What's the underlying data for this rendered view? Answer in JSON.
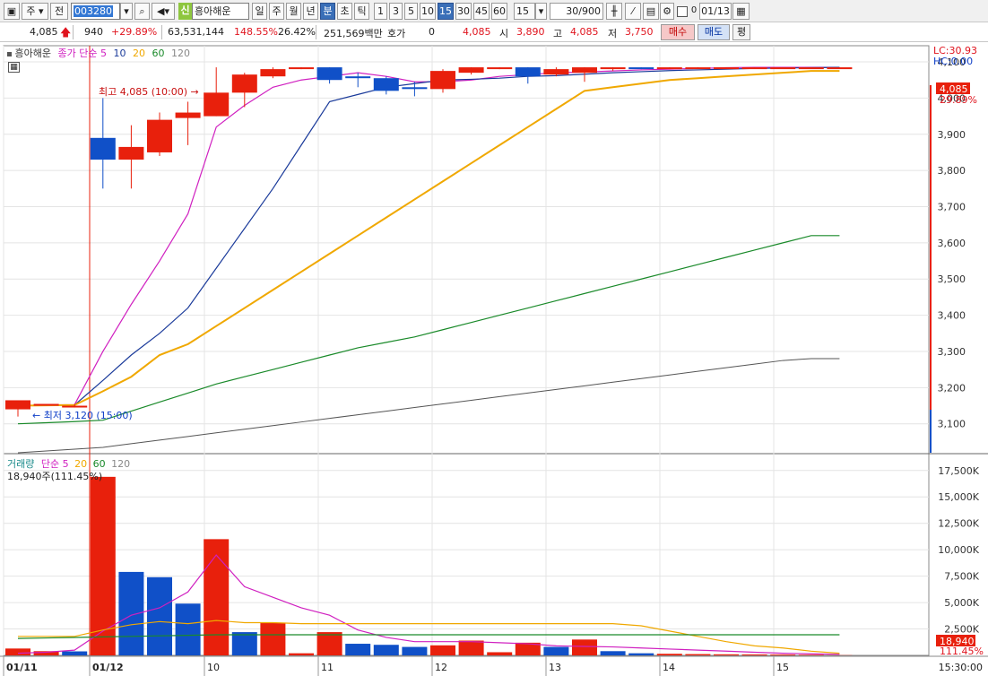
{
  "toolbar": {
    "market": "주",
    "prev_label": "전",
    "code": "003280",
    "stock_name": "흥아해운",
    "sin_label": "신",
    "periods": [
      "일",
      "주",
      "월",
      "년",
      "분",
      "초",
      "틱"
    ],
    "active_period": "분",
    "intervals": [
      "1",
      "3",
      "5",
      "10",
      "15",
      "30",
      "45",
      "60"
    ],
    "active_interval": "15",
    "interval_value": "15",
    "count": "30",
    "count_total": "/900",
    "date": "01/13"
  },
  "quote": {
    "price": "4,085",
    "change": "940",
    "change_pct": "+29.89%",
    "volume": "63,531,144",
    "volume_ratio": "148.55%",
    "turnover": "26.42%",
    "amount": "251,569백만",
    "hoga_label": "호가",
    "hoga_value": "0",
    "price2": "4,085",
    "open_label": "시",
    "open": "3,890",
    "high_label": "고",
    "high": "4,085",
    "low_label": "저",
    "low": "3,750",
    "buy_label": "매수",
    "sell_label": "매도",
    "pyeong_label": "평"
  },
  "price_panel": {
    "legend_name": "흥아해운",
    "legend_ma": "종가 단순",
    "ma_periods": [
      "5",
      "10",
      "20",
      "60",
      "120"
    ],
    "lc_label": "LC:30.93",
    "hc_label": "HC:0.00",
    "high_annot": "최고 4,085 (10:00)",
    "low_annot": "최저 3,120 (15:00)",
    "current_price_tag": "4,085",
    "current_pct_tag": "29.89%",
    "y_ticks": [
      "4,100",
      "4,000",
      "3,900",
      "3,800",
      "3,700",
      "3,600",
      "3,500",
      "3,400",
      "3,300",
      "3,200",
      "3,100"
    ]
  },
  "volume_panel": {
    "legend_name": "거래량",
    "legend_ma": "단순",
    "ma_periods": [
      "5",
      "20",
      "60",
      "120"
    ],
    "current_label": "18,940주(111.45%)",
    "current_tag": "18,940",
    "current_pct_tag": "111.45%",
    "y_ticks": [
      "17,500K",
      "15,000K",
      "12,500K",
      "10,000K",
      "7,500K",
      "5,000K",
      "2,500K"
    ]
  },
  "x_axis": {
    "labels": [
      "01/11",
      "01/12",
      "10",
      "11",
      "12",
      "13",
      "14",
      "15"
    ],
    "time_tag": "15:30:00"
  },
  "colors": {
    "up": "#e8200c",
    "down": "#1050c8",
    "ma5": "#d020c0",
    "ma10": "#1a3a9a",
    "ma20": "#f0a800",
    "ma60": "#1a8a2a",
    "ma120": "#555555"
  },
  "chart_data": {
    "type": "candlestick",
    "candles": [
      {
        "x": "01/11 15:00",
        "open": 3140,
        "high": 3165,
        "low": 3120,
        "close": 3165
      },
      {
        "x": "01/11 15:15",
        "open": 3150,
        "high": 3155,
        "low": 3150,
        "close": 3155
      },
      {
        "x": "01/11 15:30",
        "open": 3150,
        "high": 3155,
        "low": 3145,
        "close": 3150
      },
      {
        "x": "01/12 09:00",
        "open": 3890,
        "high": 4000,
        "low": 3750,
        "close": 3830
      },
      {
        "x": "01/12 09:15",
        "open": 3830,
        "high": 3925,
        "low": 3750,
        "close": 3865
      },
      {
        "x": "01/12 09:30",
        "open": 3850,
        "high": 3960,
        "low": 3840,
        "close": 3940
      },
      {
        "x": "01/12 09:45",
        "open": 3945,
        "high": 3990,
        "low": 3870,
        "close": 3960
      },
      {
        "x": "01/12 10:00",
        "open": 3950,
        "high": 4085,
        "low": 3950,
        "close": 4015
      },
      {
        "x": "01/12 10:15",
        "open": 4015,
        "high": 4070,
        "low": 3975,
        "close": 4065
      },
      {
        "x": "01/12 10:30",
        "open": 4060,
        "high": 4085,
        "low": 4055,
        "close": 4080
      },
      {
        "x": "01/12 10:45",
        "open": 4085,
        "high": 4085,
        "low": 4080,
        "close": 4085
      },
      {
        "x": "01/12 11:00",
        "open": 4085,
        "high": 4085,
        "low": 4040,
        "close": 4050
      },
      {
        "x": "01/12 11:15",
        "open": 4060,
        "high": 4070,
        "low": 4030,
        "close": 4055
      },
      {
        "x": "01/12 11:30",
        "open": 4055,
        "high": 4060,
        "low": 4010,
        "close": 4020
      },
      {
        "x": "01/12 11:45",
        "open": 4030,
        "high": 4045,
        "low": 4005,
        "close": 4025
      },
      {
        "x": "01/12 12:00",
        "open": 4025,
        "high": 4080,
        "low": 4015,
        "close": 4075
      },
      {
        "x": "01/12 12:15",
        "open": 4070,
        "high": 4085,
        "low": 4065,
        "close": 4085
      },
      {
        "x": "01/12 12:30",
        "open": 4085,
        "high": 4085,
        "low": 4080,
        "close": 4085
      },
      {
        "x": "01/12 12:45",
        "open": 4085,
        "high": 4085,
        "low": 4040,
        "close": 4060
      },
      {
        "x": "01/12 13:00",
        "open": 4065,
        "high": 4085,
        "low": 4060,
        "close": 4080
      },
      {
        "x": "01/12 13:15",
        "open": 4070,
        "high": 4085,
        "low": 4045,
        "close": 4085
      },
      {
        "x": "01/12 13:30",
        "open": 4080,
        "high": 4085,
        "low": 4075,
        "close": 4085
      },
      {
        "x": "01/12 13:45",
        "open": 4085,
        "high": 4085,
        "low": 4080,
        "close": 4082
      },
      {
        "x": "01/12 14:00",
        "open": 4082,
        "high": 4085,
        "low": 4080,
        "close": 4085
      },
      {
        "x": "01/12 14:15",
        "open": 4085,
        "high": 4085,
        "low": 4084,
        "close": 4085
      },
      {
        "x": "01/12 14:30",
        "open": 4085,
        "high": 4085,
        "low": 4084,
        "close": 4085
      },
      {
        "x": "01/12 14:45",
        "open": 4085,
        "high": 4085,
        "low": 4084,
        "close": 4085
      },
      {
        "x": "01/12 15:00",
        "open": 4085,
        "high": 4085,
        "low": 4084,
        "close": 4085
      },
      {
        "x": "01/12 15:15",
        "open": 4085,
        "high": 4085,
        "low": 4084,
        "close": 4085
      },
      {
        "x": "01/12 15:30",
        "open": 4085,
        "high": 4085,
        "low": 4084,
        "close": 4085
      }
    ],
    "volume_k": [
      650,
      400,
      380,
      16900,
      7900,
      7400,
      4900,
      11000,
      2200,
      3100,
      200,
      2200,
      1100,
      1000,
      800,
      950,
      1400,
      300,
      1200,
      800,
      1500,
      400,
      200,
      150,
      120,
      100,
      90,
      80,
      60,
      19
    ],
    "volume_up": [
      true,
      true,
      false,
      true,
      false,
      false,
      false,
      true,
      false,
      true,
      true,
      true,
      false,
      false,
      false,
      true,
      true,
      true,
      true,
      false,
      true,
      false,
      false,
      true,
      true,
      true,
      true,
      true,
      true,
      true
    ],
    "ma": {
      "5": [
        3150,
        3152,
        3153,
        3300,
        3430,
        3550,
        3680,
        3920,
        3980,
        4030,
        4050,
        4060,
        4070,
        4060,
        4045,
        4045,
        4050,
        4060,
        4065,
        4070,
        4072,
        4075,
        4078,
        4080,
        4082,
        4084,
        4085,
        4085,
        4085,
        4085
      ],
      "10": [
        3150,
        3151,
        3152,
        3220,
        3290,
        3350,
        3420,
        3530,
        3640,
        3750,
        3870,
        3990,
        4010,
        4030,
        4040,
        4050,
        4052,
        4055,
        4060,
        4062,
        4066,
        4070,
        4073,
        4076,
        4078,
        4080,
        4082,
        4083,
        4084,
        4085
      ],
      "20": [
        3150,
        3151,
        3152,
        3190,
        3230,
        3290,
        3320,
        3370,
        3420,
        3470,
        3520,
        3570,
        3620,
        3670,
        3720,
        3770,
        3820,
        3870,
        3920,
        3970,
        4020,
        4030,
        4040,
        4050,
        4055,
        4060,
        4065,
        4070,
        4075,
        4075
      ],
      "60": [
        3100,
        3103,
        3106,
        3110,
        3135,
        3160,
        3185,
        3210,
        3230,
        3250,
        3270,
        3290,
        3310,
        3325,
        3340,
        3360,
        3380,
        3400,
        3420,
        3440,
        3460,
        3480,
        3500,
        3520,
        3540,
        3560,
        3580,
        3600,
        3620,
        3620
      ],
      "120": [
        3020,
        3025,
        3030,
        3035,
        3045,
        3055,
        3065,
        3075,
        3085,
        3095,
        3105,
        3115,
        3125,
        3135,
        3145,
        3155,
        3165,
        3175,
        3185,
        3195,
        3205,
        3215,
        3225,
        3235,
        3245,
        3255,
        3265,
        3275,
        3280,
        3280
      ]
    },
    "vol_ma": {
      "5": [
        200,
        300,
        500,
        2300,
        3800,
        4500,
        6000,
        9500,
        6500,
        5500,
        4500,
        3800,
        2400,
        1700,
        1300,
        1300,
        1300,
        1200,
        1100,
        900,
        850,
        800,
        700,
        600,
        500,
        400,
        300,
        200,
        150,
        100
      ],
      "20": [
        1800,
        1800,
        1800,
        2400,
        2900,
        3200,
        3000,
        3300,
        3100,
        3100,
        3000,
        3000,
        3000,
        3000,
        3000,
        3000,
        3000,
        3000,
        3000,
        3000,
        3000,
        3000,
        2800,
        2300,
        1800,
        1300,
        900,
        700,
        400,
        200
      ],
      "60": [
        1600,
        1650,
        1700,
        1750,
        1800,
        1850,
        1900,
        1950,
        1950,
        1950,
        1950,
        1950,
        1950,
        1950,
        1950,
        1950,
        1950,
        1950,
        1950,
        1950,
        1950,
        1950,
        1950,
        1950,
        1950,
        1950,
        1950,
        1950,
        1950,
        1950
      ]
    },
    "y_range": [
      3020,
      4110
    ],
    "volume_range_k": [
      0,
      18500
    ]
  }
}
